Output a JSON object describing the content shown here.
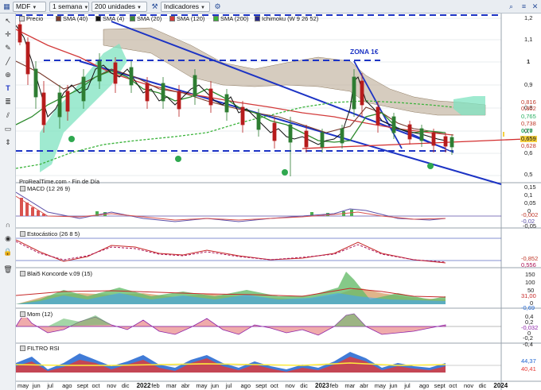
{
  "toolbar": {
    "symbol": "MDF",
    "interval": "1 semana",
    "units": "200 unidades",
    "indicators_label": "Indicadores"
  },
  "legend": [
    {
      "label": "Precio",
      "color": "#555555"
    },
    {
      "label": "SMA (40)",
      "color": "#7a3b2e"
    },
    {
      "label": "SMA (4)",
      "color": "#111111"
    },
    {
      "label": "SMA (20)",
      "color": "#3a8a3a"
    },
    {
      "label": "SMA (120)",
      "color": "#d33b3b"
    },
    {
      "label": "SMA (200)",
      "color": "#3bb33b"
    },
    {
      "label": "Ichimoku (W 9 26 52)",
      "color": "#2a2a8a"
    }
  ],
  "annotations": {
    "zona": "ZONA 1€",
    "source": "ProRealTime.com - Fin de Día"
  },
  "price_axis": [
    "1,2",
    "1,1",
    "1",
    "0,9",
    "0,8",
    "0,7",
    "0,6",
    "0,5"
  ],
  "price_tags": [
    {
      "text": "0,816",
      "color": "#c0392b",
      "bg": "transparent"
    },
    {
      "text": "0,802",
      "color": "#c0392b",
      "bg": "transparent"
    },
    {
      "text": "0,765",
      "color": "#27ae60",
      "bg": "transparent"
    },
    {
      "text": "0,738",
      "color": "#c0392b",
      "bg": "transparent"
    },
    {
      "text": "0,70",
      "color": "#27ae60",
      "bg": "transparent"
    },
    {
      "text": "0,659",
      "color": "#111111",
      "bg": "#f4d03f"
    },
    {
      "text": "0,628",
      "color": "#c0392b",
      "bg": "transparent"
    }
  ],
  "panels": {
    "macd": {
      "label": "MACD (12 26 9)",
      "axis": [
        "0,15",
        "0,1",
        "0,05",
        "0",
        "-0,05"
      ],
      "tags": [
        "-0,002",
        "-0,02"
      ]
    },
    "stoch": {
      "label": "Estocástico (26 8 5)",
      "axis": [],
      "tags": [
        "-0,852",
        "0,556"
      ]
    },
    "blai5": {
      "label": "Blai5 Koncorde v.09 (15)",
      "axis": [
        "150",
        "100",
        "50",
        "0"
      ],
      "tags": [
        "31,00",
        "-0,69"
      ]
    },
    "mom": {
      "label": "Mom (12)",
      "axis": [
        "0,4",
        "0,2",
        "0",
        "-0,2",
        "-0,4"
      ],
      "tags": [
        "-0,032"
      ]
    },
    "rsi": {
      "label": "FILTRO RSI",
      "axis": [],
      "tags": [
        "44,37",
        "40,41"
      ]
    }
  },
  "months": [
    {
      "text": "may",
      "year": false
    },
    {
      "text": "jun",
      "year": false
    },
    {
      "text": "jul",
      "year": false
    },
    {
      "text": "ago",
      "year": false
    },
    {
      "text": "sept",
      "year": false
    },
    {
      "text": "oct",
      "year": false
    },
    {
      "text": "nov",
      "year": false
    },
    {
      "text": "dic",
      "year": false
    },
    {
      "text": "2022",
      "year": true
    },
    {
      "text": "feb",
      "year": false
    },
    {
      "text": "mar",
      "year": false
    },
    {
      "text": "abr",
      "year": false
    },
    {
      "text": "may",
      "year": false
    },
    {
      "text": "jun",
      "year": false
    },
    {
      "text": "jul",
      "year": false
    },
    {
      "text": "ago",
      "year": false
    },
    {
      "text": "sept",
      "year": false
    },
    {
      "text": "oct",
      "year": false
    },
    {
      "text": "nov",
      "year": false
    },
    {
      "text": "dic",
      "year": false
    },
    {
      "text": "2023",
      "year": true
    },
    {
      "text": "feb",
      "year": false
    },
    {
      "text": "mar",
      "year": false
    },
    {
      "text": "abr",
      "year": false
    },
    {
      "text": "may",
      "year": false
    },
    {
      "text": "jun",
      "year": false
    },
    {
      "text": "jul",
      "year": false
    },
    {
      "text": "ago",
      "year": false
    },
    {
      "text": "sept",
      "year": false
    },
    {
      "text": "oct",
      "year": false
    },
    {
      "text": "nov",
      "year": false
    },
    {
      "text": "dic",
      "year": false
    },
    {
      "text": "2024",
      "year": true
    }
  ],
  "colors": {
    "channel": "#1c33c4",
    "candle_up": "#2e7d32",
    "candle_down": "#b71c1c",
    "cloud": "#b5a38a",
    "cloud_green": "#7fe3c0"
  },
  "chart_data": {
    "type": "line",
    "title": "",
    "x": [
      "2021-05",
      "2021-06",
      "2021-07",
      "2021-08",
      "2021-09",
      "2021-10",
      "2021-11",
      "2021-12",
      "2022-01",
      "2022-02",
      "2022-03",
      "2022-04",
      "2022-05",
      "2022-06",
      "2022-07",
      "2022-08",
      "2022-09",
      "2022-10",
      "2022-11",
      "2022-12",
      "2023-01",
      "2023-02",
      "2023-03",
      "2023-04",
      "2023-05",
      "2023-06",
      "2023-07",
      "2023-08"
    ],
    "series": [
      {
        "values": [
          1.18,
          1.05,
          0.88,
          0.95,
          1.0,
          0.97,
          0.96,
          0.92,
          0.91,
          0.86,
          0.9,
          0.92,
          0.86,
          0.84,
          0.82,
          0.8,
          0.76,
          0.71,
          0.68,
          0.69,
          0.68,
          0.95,
          0.82,
          0.75,
          0.72,
          0.72,
          0.7,
          0.659
        ]
      }
    ],
    "ylim": [
      0.5,
      1.2
    ]
  },
  "icons": {
    "left_tools": [
      "pointer-icon",
      "crosshair-icon",
      "pencil-icon",
      "line-icon",
      "zoom-icon",
      "text-icon",
      "fibonacci-icon",
      "channel-icon",
      "shape-icon",
      "measure-icon",
      "magnet-icon",
      "eye-icon",
      "lock-icon",
      "trash-icon"
    ]
  }
}
